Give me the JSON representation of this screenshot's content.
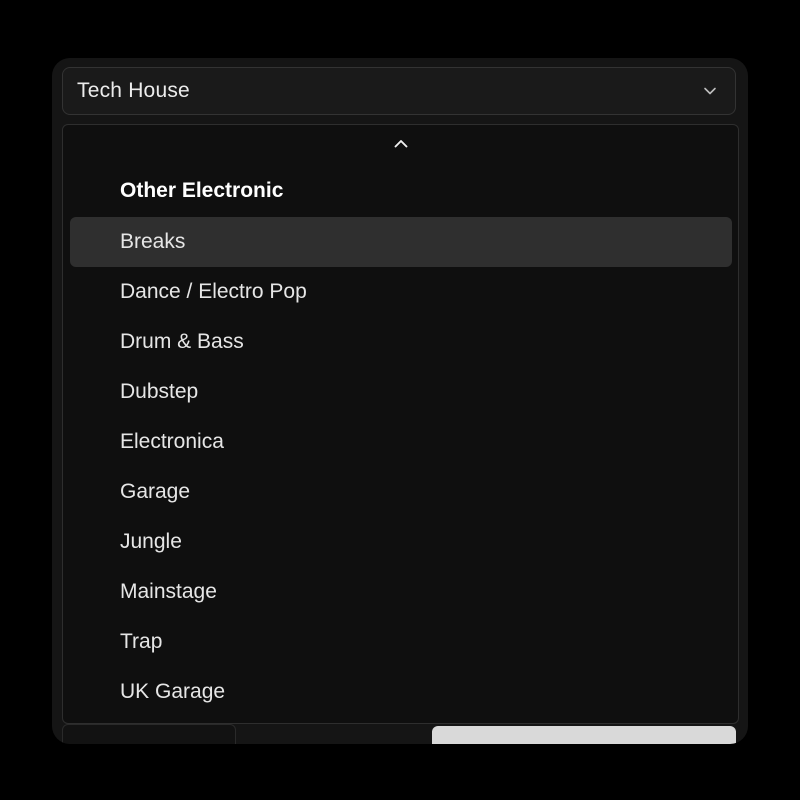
{
  "select": {
    "value": "Tech House",
    "icon": "chevron-down-icon"
  },
  "listbox": {
    "scroll_up_icon": "chevron-up-icon",
    "group_label": "Other Electronic",
    "highlighted_index": 0,
    "options": [
      {
        "label": "Breaks"
      },
      {
        "label": "Dance / Electro Pop"
      },
      {
        "label": "Drum & Bass"
      },
      {
        "label": "Dubstep"
      },
      {
        "label": "Electronica"
      },
      {
        "label": "Garage"
      },
      {
        "label": "Jungle"
      },
      {
        "label": "Mainstage"
      },
      {
        "label": "Trap"
      },
      {
        "label": "UK Garage"
      }
    ]
  },
  "colors": {
    "background": "#000000",
    "panel": "#151515",
    "highlight": "#2f2f2f",
    "text": "#e6e6e6"
  }
}
